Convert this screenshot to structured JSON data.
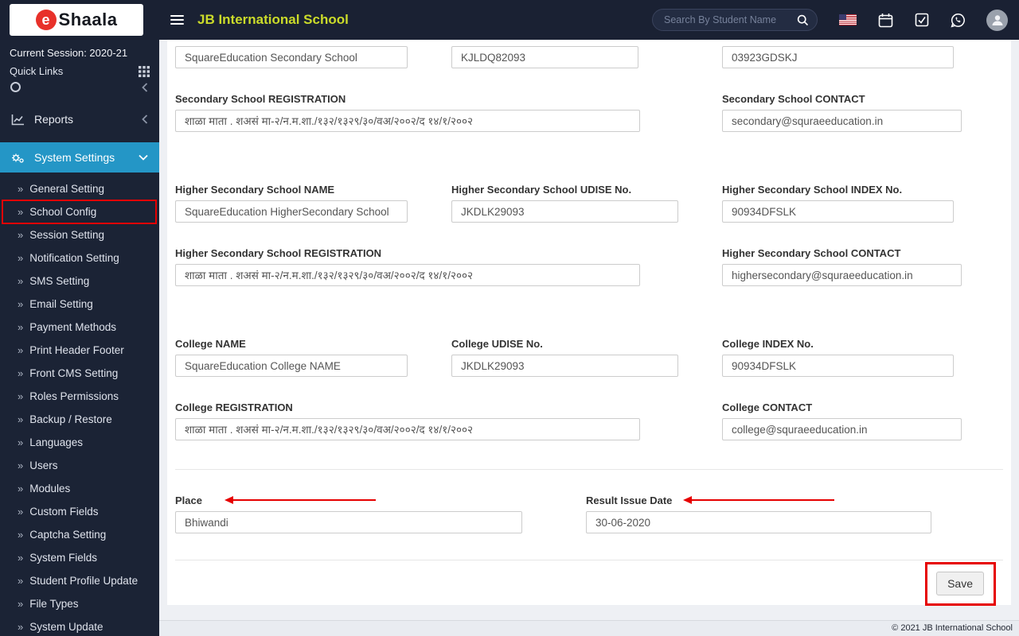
{
  "topbar": {
    "brand_letter": "e",
    "brand_text": "Shaala",
    "school_name": "JB International School",
    "search_placeholder": "Search By Student Name",
    "icons": [
      "menu-icon",
      "search-icon",
      "us-flag-icon",
      "calendar-icon",
      "tasks-icon",
      "whatsapp-icon",
      "avatar"
    ]
  },
  "sidebar": {
    "session": "Current Session: 2020-21",
    "quick_links": "Quick Links",
    "reports_label": "Reports",
    "system_settings_label": "System Settings",
    "submenu_marker": "»",
    "submenu": [
      "General Setting",
      "School Config",
      "Session Setting",
      "Notification Setting",
      "SMS Setting",
      "Email Setting",
      "Payment Methods",
      "Print Header Footer",
      "Front CMS Setting",
      "Roles Permissions",
      "Backup / Restore",
      "Languages",
      "Users",
      "Modules",
      "Custom Fields",
      "Captcha Setting",
      "System Fields",
      "Student Profile Update",
      "File Types",
      "System Update"
    ],
    "annotated_item": "School Config"
  },
  "form": {
    "sections": [
      {
        "name": "secondary",
        "row1": [
          {
            "label": "",
            "value": "SquareEducation Secondary School"
          },
          {
            "label": "",
            "value": "KJLDQ82093"
          },
          {
            "label": "",
            "value": "03923GDSKJ"
          }
        ],
        "row2": [
          {
            "label": "Secondary School REGISTRATION",
            "value": "शाळा माता . शअसं मा-२/न.म.शा./१३२/१३२९/३०/वअ/२००२/द १४/१/२००२"
          },
          {
            "label": "Secondary School CONTACT",
            "value": "secondary@squraeeducation.in"
          }
        ]
      },
      {
        "name": "higher-secondary",
        "row1": [
          {
            "label": "Higher Secondary School NAME",
            "value": "SquareEducation HigherSecondary School"
          },
          {
            "label": "Higher Secondary School UDISE No.",
            "value": "JKDLK29093"
          },
          {
            "label": "Higher Secondary School INDEX No.",
            "value": "90934DFSLK"
          }
        ],
        "row2": [
          {
            "label": "Higher Secondary School REGISTRATION",
            "value": "शाळा माता . शअसं मा-२/न.म.शा./१३२/१३२९/३०/वअ/२००२/द १४/१/२००२"
          },
          {
            "label": "Higher Secondary School CONTACT",
            "value": "highersecondary@squraeeducation.in"
          }
        ]
      },
      {
        "name": "college",
        "row1": [
          {
            "label": "College NAME",
            "value": "SquareEducation College NAME"
          },
          {
            "label": "College UDISE No.",
            "value": "JKDLK29093"
          },
          {
            "label": "College INDEX No.",
            "value": "90934DFSLK"
          }
        ],
        "row2": [
          {
            "label": "College REGISTRATION",
            "value": "शाळा माता . शअसं मा-२/न.म.शा./१३२/१३२९/३०/वअ/२००२/द १४/१/२००२"
          },
          {
            "label": "College CONTACT",
            "value": "college@squraeeducation.in"
          }
        ]
      }
    ],
    "place": {
      "label": "Place",
      "value": "Bhiwandi"
    },
    "result_issue_date": {
      "label": "Result Issue Date",
      "value": "30-06-2020"
    },
    "save_label": "Save"
  },
  "footer": {
    "copyright": "© 2021 JB International School"
  },
  "colors": {
    "topbar_bg": "#1a2133",
    "sidebar_bg": "#1b2335",
    "active_nav_bg": "#2496c6",
    "brand_accent": "#cbdb2a",
    "annotation_red": "#e60000"
  }
}
